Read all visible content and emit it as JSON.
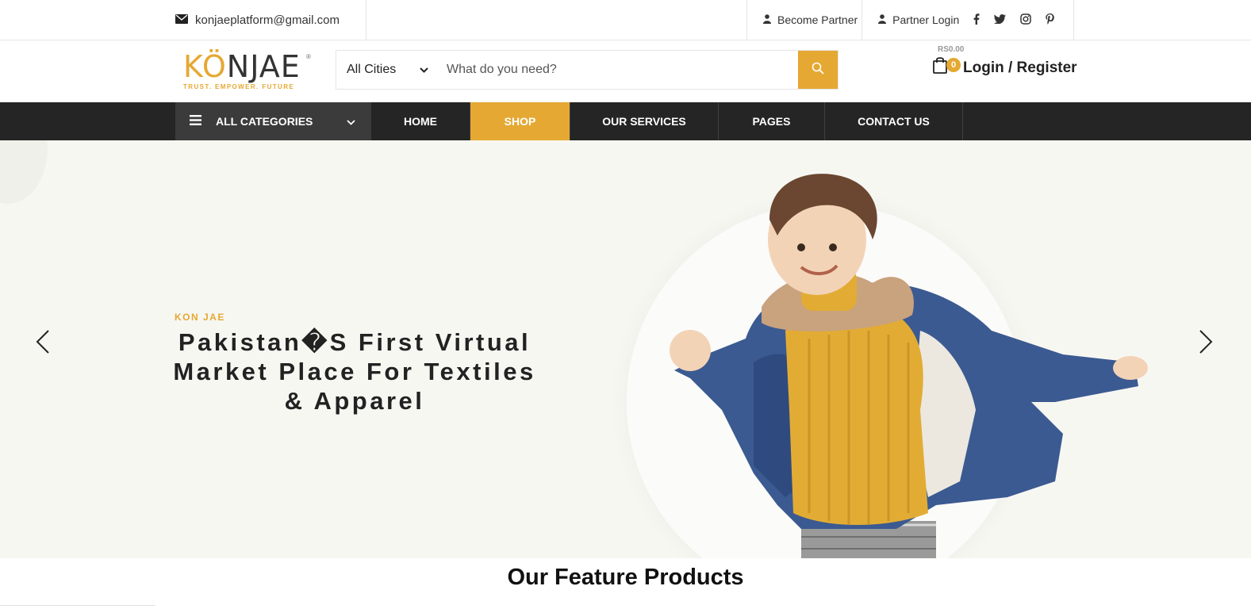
{
  "topbar": {
    "email": "konjaeplatform@gmail.com",
    "become_partner": "Become Partner",
    "partner_login": "Partner Login",
    "social": [
      "facebook-icon",
      "twitter-icon",
      "instagram-icon",
      "pinterest-icon"
    ]
  },
  "header": {
    "logo_word_1": "K",
    "logo_word_2": "Ö",
    "logo_word_3": "NJAE",
    "logo_tagline": "TRUST. EMPOWER. FUTURE",
    "logo_reg": "®",
    "city_select": "All Cities",
    "search_placeholder": "What do you need?",
    "cart_amount": "RS0.00",
    "cart_count": "0",
    "login": "Login / Register"
  },
  "nav": {
    "all_categories": "ALL CATEGORIES",
    "items": [
      "HOME",
      "SHOP",
      "OUR SERVICES",
      "PAGES",
      "CONTACT US"
    ],
    "active": "SHOP"
  },
  "hero": {
    "eyebrow": "KON JAE",
    "headline": "Pakistan�S First Virtual Market Place For Textiles & Apparel"
  },
  "section_title": "Our Feature Products",
  "colors": {
    "accent": "#e5a832",
    "nav_bg": "#252525",
    "hero_bg": "#f7f7f2"
  }
}
